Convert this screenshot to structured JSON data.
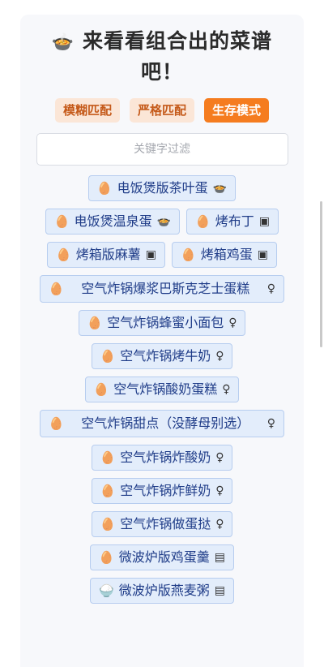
{
  "header": {
    "icon": "🍲",
    "title": "来看看组合出的菜谱吧！"
  },
  "modes": [
    {
      "label": "模糊匹配",
      "active": false
    },
    {
      "label": "严格匹配",
      "active": false
    },
    {
      "label": "生存模式",
      "active": true
    }
  ],
  "filter": {
    "placeholder": "关键字过滤",
    "value": ""
  },
  "icons": {
    "egg": "🥚",
    "rice": "🍚",
    "rice_cooker": "rice-cooker-icon",
    "oven": "oven-icon",
    "air_fryer": "air-fryer-icon",
    "microwave": "microwave-icon"
  },
  "recipes": [
    {
      "food": "🥚",
      "name": "电饭煲版茶叶蛋",
      "tool": "🍲"
    },
    {
      "food": "🥚",
      "name": "电饭煲温泉蛋",
      "tool": "🍲"
    },
    {
      "food": "🥚",
      "name": "烤布丁",
      "tool": "▣"
    },
    {
      "food": "🥚",
      "name": "烤箱版麻薯",
      "tool": "▣"
    },
    {
      "food": "🥚",
      "name": "烤箱鸡蛋",
      "tool": "▣"
    },
    {
      "food": "🥚",
      "name": "空气炸锅爆浆巴斯克芝士蛋糕",
      "tool": "♀",
      "wide": true
    },
    {
      "food": "🥚",
      "name": "空气炸锅蜂蜜小面包",
      "tool": "♀"
    },
    {
      "food": "🥚",
      "name": "空气炸锅烤牛奶",
      "tool": "♀"
    },
    {
      "food": "🥚",
      "name": "空气炸锅酸奶蛋糕",
      "tool": "♀"
    },
    {
      "food": "🥚",
      "name": "空气炸锅甜点（没酵母别选）",
      "tool": "♀",
      "wide": true
    },
    {
      "food": "🥚",
      "name": "空气炸锅炸酸奶",
      "tool": "♀"
    },
    {
      "food": "🥚",
      "name": "空气炸锅炸鲜奶",
      "tool": "♀"
    },
    {
      "food": "🥚",
      "name": "空气炸锅做蛋挞",
      "tool": "♀"
    },
    {
      "food": "🥚",
      "name": "微波炉版鸡蛋羹",
      "tool": "▤"
    },
    {
      "food": "🍚",
      "name": "微波炉版燕麦粥",
      "tool": "▤"
    }
  ]
}
